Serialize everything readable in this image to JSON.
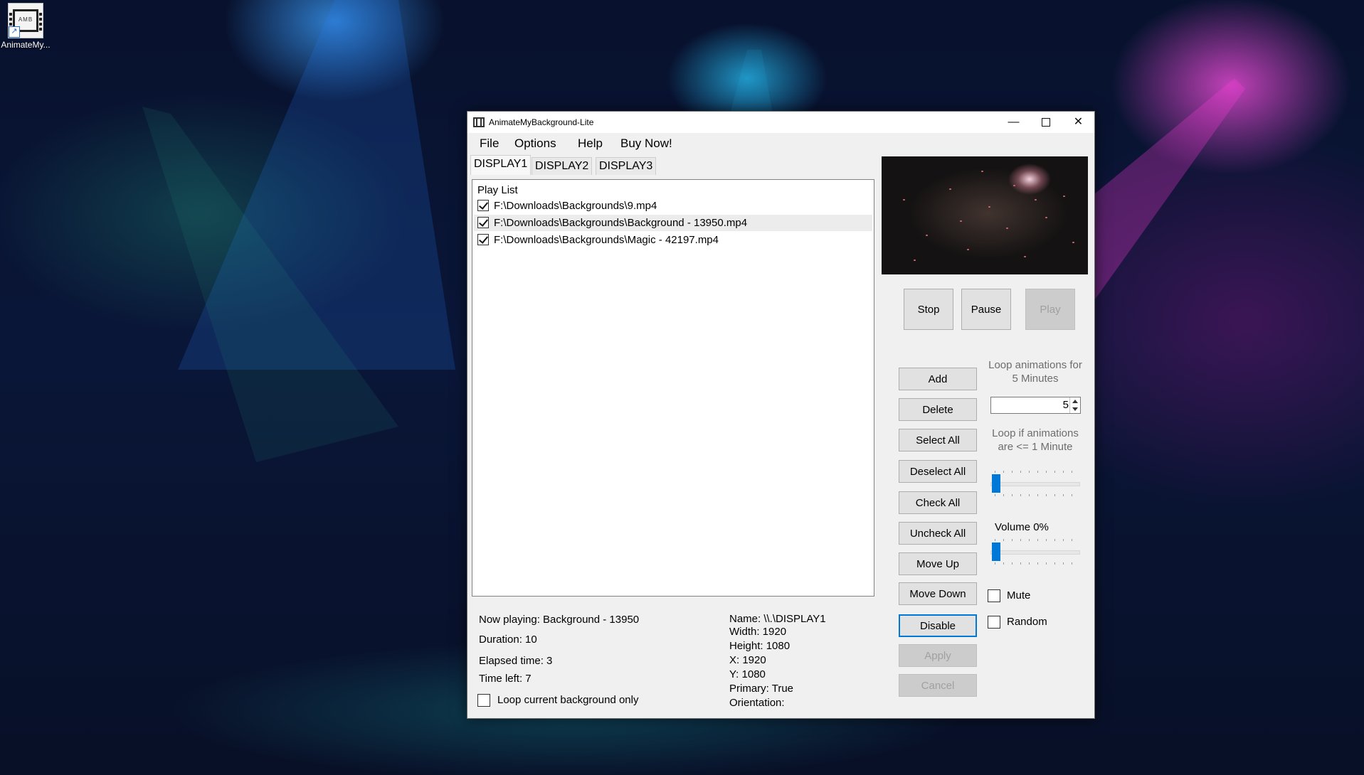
{
  "desktop": {
    "icon_label": "AnimateMy...",
    "icon_tile_text": "AMB",
    "icon_name": "film-strip-icon"
  },
  "window": {
    "title": "AnimateMyBackground-Lite",
    "controls": {
      "minimize": "—",
      "maximize": "☐",
      "close": "✕"
    }
  },
  "menu": {
    "items": [
      "File",
      "Options",
      "Help",
      "Buy Now!"
    ]
  },
  "tabs": [
    "DISPLAY1",
    "DISPLAY2",
    "DISPLAY3"
  ],
  "playlist": {
    "header": "Play List",
    "items": [
      {
        "path": "F:\\Downloads\\Backgrounds\\9.mp4",
        "checked": true,
        "selected": false
      },
      {
        "path": "F:\\Downloads\\Backgrounds\\Background - 13950.mp4",
        "checked": true,
        "selected": true
      },
      {
        "path": "F:\\Downloads\\Backgrounds\\Magic - 42197.mp4",
        "checked": true,
        "selected": false
      }
    ]
  },
  "playback": {
    "stop": "Stop",
    "pause": "Pause",
    "play": "Play"
  },
  "actions": {
    "add": "Add",
    "delete": "Delete",
    "select_all": "Select All",
    "deselect_all": "Deselect All",
    "check_all": "Check All",
    "uncheck_all": "Uncheck All",
    "move_up": "Move Up",
    "move_down": "Move Down",
    "disable": "Disable",
    "apply": "Apply",
    "cancel": "Cancel"
  },
  "settings": {
    "loop_for_line1": "Loop animations for",
    "loop_for_line2": "5 Minutes",
    "loop_minutes": "5",
    "loop_if_line1": "Loop if animations",
    "loop_if_line2": "are <= 1 Minute",
    "loop_if_value": 1,
    "volume_label": "Volume 0%",
    "volume_percent": 0,
    "mute_label": "Mute",
    "random_label": "Random"
  },
  "status": {
    "now_playing": "Now playing: Background - 13950",
    "duration": "Duration: 10",
    "elapsed": "Elapsed time: 3",
    "time_left": "Time left: 7",
    "loop_current": "Loop current background only"
  },
  "display_info": {
    "name": "Name: \\\\.\\DISPLAY1",
    "width": "Width: 1920",
    "height": "Height: 1080",
    "x": "X: 1920",
    "y": "Y: 1080",
    "primary": "Primary: True",
    "orientation": "Orientation:"
  },
  "colors": {
    "accent": "#0078d7",
    "window_bg": "#f0f0f0"
  }
}
